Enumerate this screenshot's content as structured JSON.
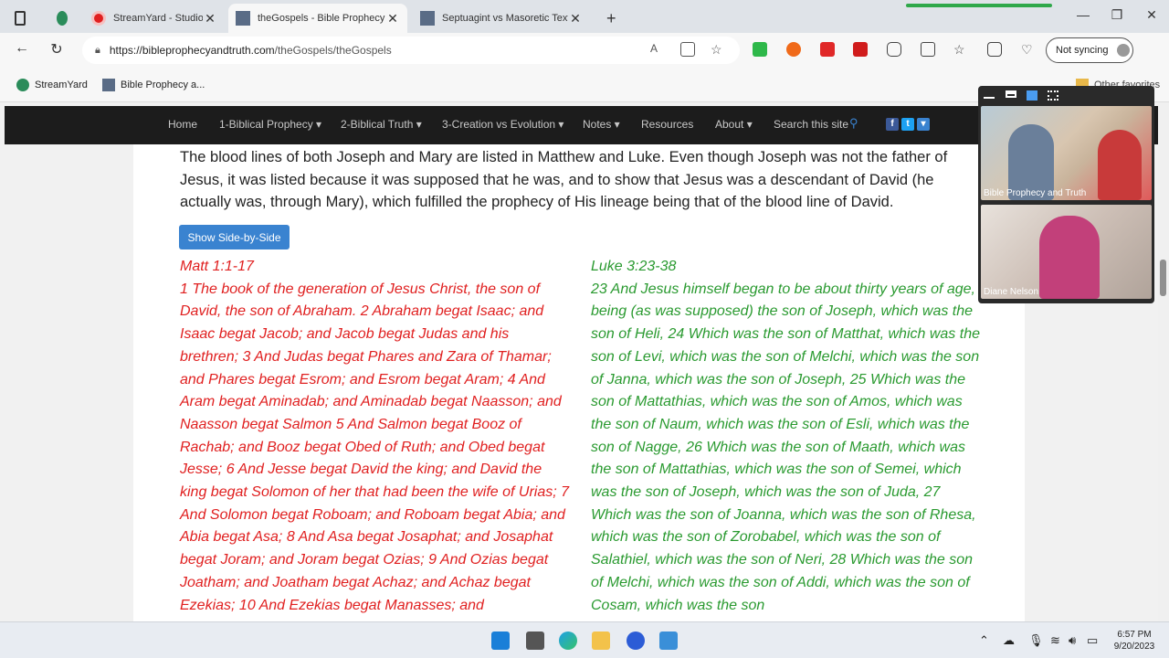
{
  "browser": {
    "tabs": [
      {
        "label": ""
      },
      {
        "label": "StreamYard - Studio"
      },
      {
        "label": "theGospels - Bible Prophecy"
      },
      {
        "label": "Septuagint vs Masoretic Text"
      }
    ],
    "new_tab_glyph": "+",
    "url_host": "https://bibleprophecyandtruth.com",
    "url_path": "/theGospels/theGospels",
    "sync_label": "Not syncing",
    "bookmarks": [
      "StreamYard",
      "Bible Prophecy a..."
    ],
    "other_favorites": "Other favorites"
  },
  "site_nav": {
    "items": [
      "Home",
      "1-Biblical Prophecy ▾",
      "2-Biblical Truth ▾",
      "3-Creation vs Evolution ▾",
      "Notes ▾",
      "Resources",
      "About ▾",
      "Search this site"
    ],
    "social": [
      "f",
      "t",
      "▾"
    ]
  },
  "article": {
    "intro": "The blood lines of both Joseph and Mary are listed in Matthew and Luke. Even though Joseph was not the father of Jesus, it was listed because it was supposed that he was, and to show that Jesus was a descendant of David (he actually was, through Mary), which fulfilled the prophecy of His lineage being that of the blood line of David.",
    "button_label": "Show Side-by-Side",
    "left_ref": "Matt 1:1-17",
    "left_text": "1 The book of the generation of Jesus Christ, the son of David, the son of Abraham. 2 Abraham begat Isaac; and Isaac begat Jacob; and Jacob begat Judas and his brethren; 3 And Judas begat Phares and Zara of Thamar; and Phares begat Esrom; and Esrom begat Aram; 4 And Aram begat Aminadab; and Aminadab begat Naasson; and Naasson begat Salmon 5 And Salmon begat Booz of Rachab; and Booz begat Obed of Ruth; and Obed begat Jesse; 6 And Jesse begat David the king; and David the king begat Solomon of her that had been the wife of Urias; 7 And Solomon begat Roboam; and Roboam begat Abia; and Abia begat Asa; 8 And Asa begat Josaphat; and Josaphat begat Joram; and Joram begat Ozias; 9 And Ozias begat Joatham; and Joatham begat Achaz; and Achaz begat Ezekias; 10 And Ezekias begat Manasses; and",
    "right_ref": "Luke 3:23-38",
    "right_text": "23 And Jesus himself began to be about thirty years of age, being (as was supposed) the son of Joseph, which was the son of Heli, 24 Which was the son of Matthat, which was the son of Levi, which was the son of Melchi, which was the son of Janna, which was the son of Joseph, 25 Which was the son of Mattathias, which was the son of Amos, which was the son of Naum, which was the son of Esli, which was the son of Nagge, 26 Which was the son of Maath, which was the son of Mattathias, which was the son of Semei, which was the son of Joseph, which was the son of Juda, 27 Which was the son of Joanna, which was the son of Rhesa, which was the son of Zorobabel, which was the son of Salathiel, which was the son of Neri, 28 Which was the son of Melchi, which was the son of Addi, which was the son of Cosam, which was the son"
  },
  "video": {
    "tile1_label": "Bible Prophecy and Truth",
    "tile2_label": "Diane Nelson"
  },
  "taskbar": {
    "time": "6:57 PM",
    "date": "9/20/2023"
  },
  "colors": {
    "nav_bg": "#1c1c1c",
    "matthew_red": "#e02020",
    "luke_green": "#2a9a30",
    "button_blue": "#3a83d0"
  }
}
